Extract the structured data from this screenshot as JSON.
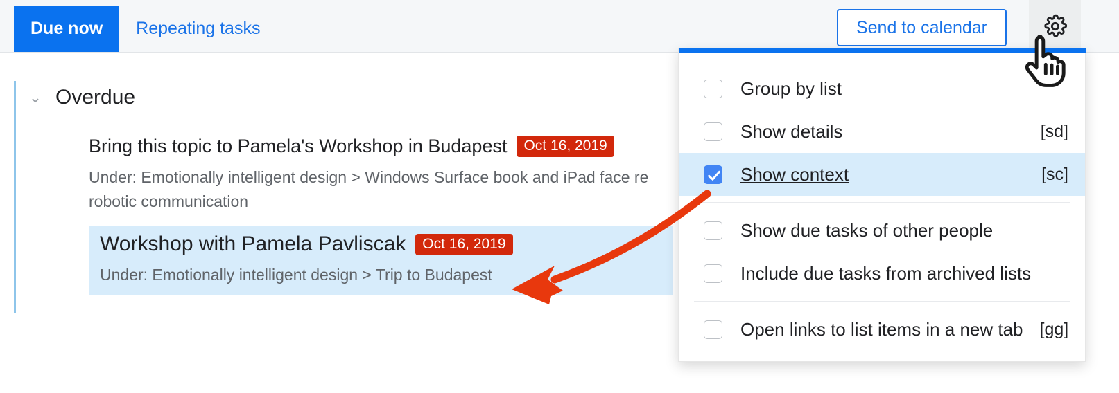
{
  "header": {
    "tabs": [
      {
        "label": "Due now",
        "active": true
      },
      {
        "label": "Repeating tasks",
        "active": false
      }
    ],
    "send_to_calendar_label": "Send to calendar",
    "gear_icon": "gear-icon"
  },
  "content": {
    "group": {
      "title": "Overdue",
      "chevron": "⌄",
      "expanded": true
    },
    "tasks": [
      {
        "title": "Bring this topic to Pamela's Workshop in Budapest",
        "due": "Oct 16, 2019",
        "context": "Under: Emotionally intelligent design > Windows Surface book and iPad face re",
        "context_line2": "robotic communication",
        "selected": false
      },
      {
        "title": "Workshop with Pamela Pavliscak",
        "due": "Oct 16, 2019",
        "context": "Under: Emotionally intelligent design > Trip to Budapest",
        "context_line2": "",
        "selected": true
      }
    ]
  },
  "settings_menu": {
    "items": [
      {
        "label": "Group by list",
        "shortcut": "",
        "checked": false,
        "selected": false
      },
      {
        "label": "Show details",
        "shortcut": "[sd]",
        "checked": false,
        "selected": false
      },
      {
        "label": "Show context",
        "shortcut": "[sc]",
        "checked": true,
        "selected": true
      },
      {
        "label": "Show due tasks of other people",
        "shortcut": "",
        "checked": false,
        "selected": false
      },
      {
        "label": "Include due tasks from archived lists",
        "shortcut": "",
        "checked": false,
        "selected": false
      },
      {
        "label": "Open links to list items in a new tab",
        "shortcut": "[gg]",
        "checked": false,
        "selected": false
      }
    ]
  },
  "annotations": {
    "arrow_color": "#e8380d",
    "cursor_icon": "pointing-hand-cursor"
  },
  "colors": {
    "accent_blue": "#0a72ef",
    "link_blue": "#1a73e8",
    "due_red": "#d2280b",
    "selection_blue": "#d7ecfb",
    "rail_blue": "#8ec5ea",
    "header_bg": "#f5f7f9"
  }
}
